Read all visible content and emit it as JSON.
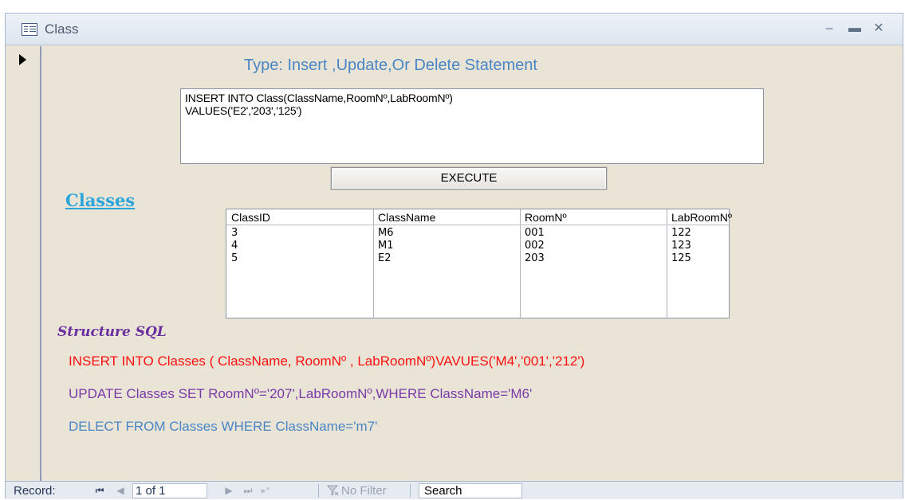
{
  "window": {
    "title": "Class"
  },
  "form": {
    "heading": "Type: Insert ,Update,Or Delete Statement",
    "sql_text": [
      "INSERT INTO Class(ClassName,RoomNº,LabRoomNº)",
      "VALUES('E2','203','125')"
    ],
    "execute_label": "EXECUTE",
    "classes_link": "Classes"
  },
  "classes_list": {
    "columns": [
      "ClassID",
      "ClassName",
      "RoomNº",
      "LabRoomNº"
    ],
    "rows": [
      [
        "3",
        "M6",
        "001",
        "122"
      ],
      [
        "4",
        "M1",
        "002",
        "123"
      ],
      [
        "5",
        "E2",
        "203",
        "125"
      ]
    ]
  },
  "structure_sql": {
    "label": "Structure SQL",
    "insert": "INSERT INTO Classes ( ClassName, RoomNº , LabRoomNº)VAVUES('M4','001','212')",
    "update": "UPDATE Classes SET RoomNº='207',LabRoomNº,WHERE ClassName='M6'",
    "delete": "DELECT FROM Classes WHERE ClassName='m7'"
  },
  "navigation": {
    "record_label": "Record:",
    "first_icon": "⏮",
    "prev_icon": "◀",
    "record_position": "1 of 1",
    "next_icon": "▶",
    "last_icon": "⏭",
    "new_icon": "new-record",
    "filter_text": "No Filter",
    "search_text": "Search"
  },
  "colors": {
    "form_background": "#e9e4d6",
    "heading_blue": "#4a86c5",
    "insert_red": "#ff1010",
    "update_purple": "#7a3aa8",
    "link_blue": "#2aa6db"
  }
}
